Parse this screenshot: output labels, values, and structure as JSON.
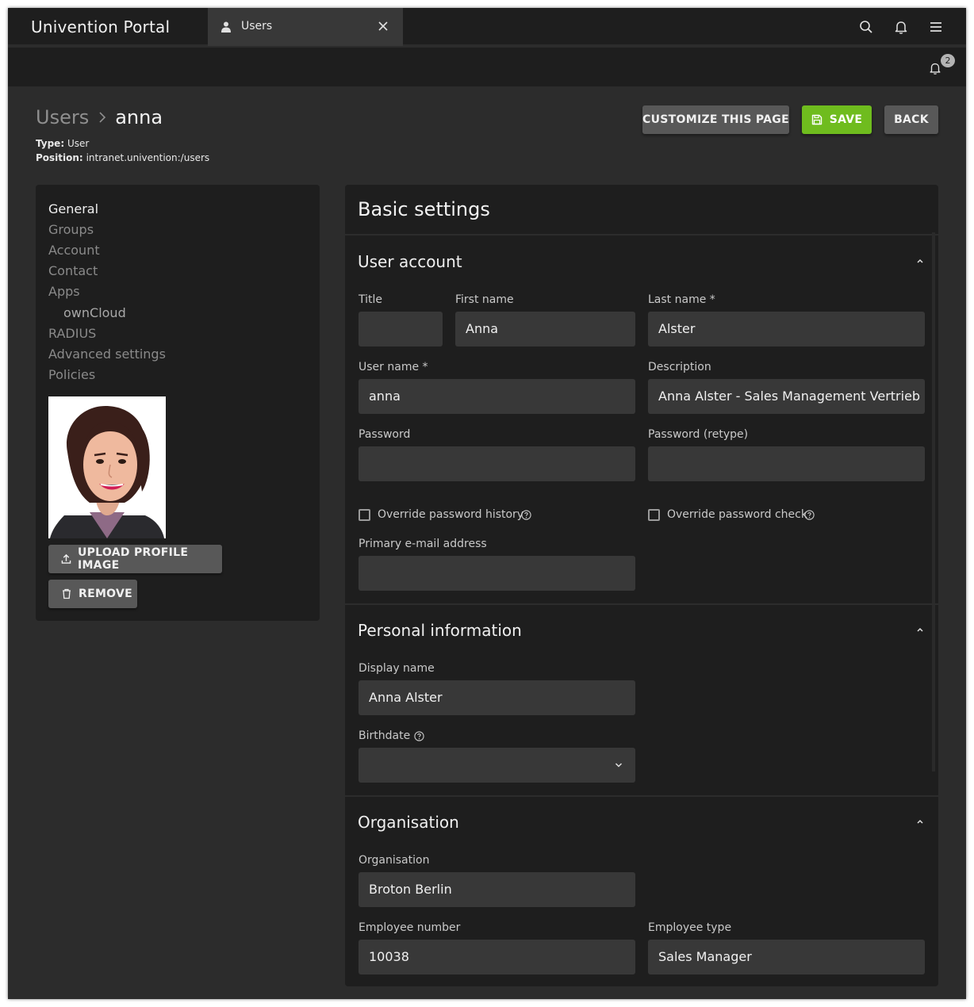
{
  "app": {
    "title": "Univention Portal"
  },
  "tabs": [
    {
      "label": "Users"
    }
  ],
  "notifications": {
    "count": "2"
  },
  "breadcrumb": {
    "parent": "Users",
    "current": "anna"
  },
  "meta": {
    "type_label": "Type:",
    "type_value": "User",
    "position_label": "Position:",
    "position_value": "intranet.univention:/users"
  },
  "toolbar": {
    "customize_label": "CUSTOMIZE THIS PAGE",
    "save_label": "SAVE",
    "back_label": "BACK"
  },
  "sidebar": {
    "items": [
      {
        "label": "General",
        "active": true
      },
      {
        "label": "Groups"
      },
      {
        "label": "Account"
      },
      {
        "label": "Contact"
      },
      {
        "label": "Apps"
      },
      {
        "label": "ownCloud",
        "sub": true
      },
      {
        "label": "RADIUS"
      },
      {
        "label": "Advanced settings"
      },
      {
        "label": "Policies"
      }
    ],
    "upload_label": "UPLOAD PROFILE IMAGE",
    "remove_label": "REMOVE"
  },
  "main": {
    "title": "Basic settings",
    "sections": {
      "user_account": {
        "title": "User account",
        "title_field": {
          "label": "Title",
          "value": ""
        },
        "first_name": {
          "label": "First name",
          "value": "Anna"
        },
        "last_name": {
          "label": "Last name *",
          "value": "Alster"
        },
        "user_name": {
          "label": "User name *",
          "value": "anna"
        },
        "description": {
          "label": "Description",
          "value": "Anna Alster - Sales Management Vertrieb"
        },
        "password": {
          "label": "Password",
          "value": ""
        },
        "password_retype": {
          "label": "Password (retype)",
          "value": ""
        },
        "override_history": {
          "label": "Override password history",
          "checked": false
        },
        "override_check": {
          "label": "Override password check",
          "checked": false
        },
        "primary_email": {
          "label": "Primary e-mail address",
          "value": ""
        }
      },
      "personal": {
        "title": "Personal information",
        "display_name": {
          "label": "Display name",
          "value": "Anna Alster"
        },
        "birthdate": {
          "label": "Birthdate",
          "value": ""
        }
      },
      "organisation": {
        "title": "Organisation",
        "organisation": {
          "label": "Organisation",
          "value": "Broton Berlin"
        },
        "employee_number": {
          "label": "Employee number",
          "value": "10038"
        },
        "employee_type": {
          "label": "Employee type",
          "value": "Sales Manager"
        }
      }
    }
  },
  "colors": {
    "accent": "#6fbc1e",
    "background": "#2c2c2c",
    "card": "#1e1e1e",
    "input": "#383838"
  }
}
